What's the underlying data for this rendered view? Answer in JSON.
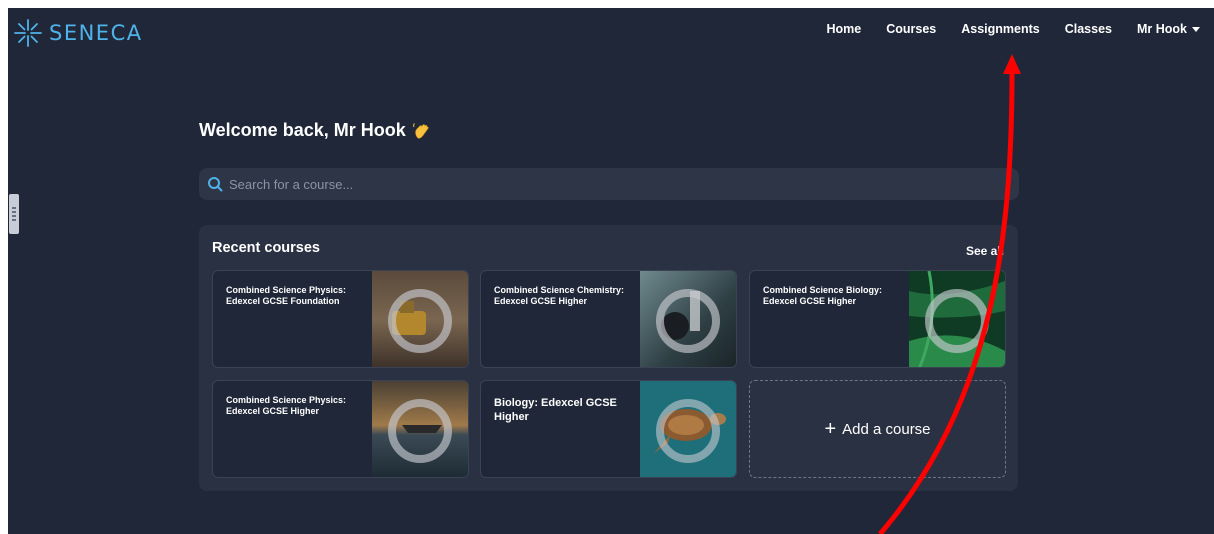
{
  "brand": {
    "name": "SENECA",
    "color": "#4fb3ea"
  },
  "nav": {
    "items": [
      "Home",
      "Courses",
      "Assignments",
      "Classes"
    ],
    "user": "Mr Hook"
  },
  "welcome": {
    "text": "Welcome back, Mr Hook",
    "emoji_icon": "waving-hand-icon"
  },
  "search": {
    "placeholder": "Search for a course..."
  },
  "recent": {
    "title": "Recent courses",
    "see_all": "See all",
    "courses": [
      {
        "title": "Combined Science Physics: Edexcel GCSE Foundation",
        "image": "yellow-submarine-photo"
      },
      {
        "title": "Combined Science Chemistry: Edexcel GCSE Higher",
        "image": "lab-scientist-photo"
      },
      {
        "title": "Combined Science Biology: Edexcel GCSE Higher",
        "image": "green-leaves-photo"
      },
      {
        "title": "Combined Science Physics: Edexcel GCSE Higher",
        "image": "boat-sea-sunset-photo"
      },
      {
        "title": "Biology: Edexcel GCSE Higher",
        "image": "sea-turtle-photo"
      }
    ],
    "add_course": "Add a course"
  },
  "colors": {
    "background": "#202738",
    "panel": "#2a3142",
    "annotation": "#ff0000"
  }
}
